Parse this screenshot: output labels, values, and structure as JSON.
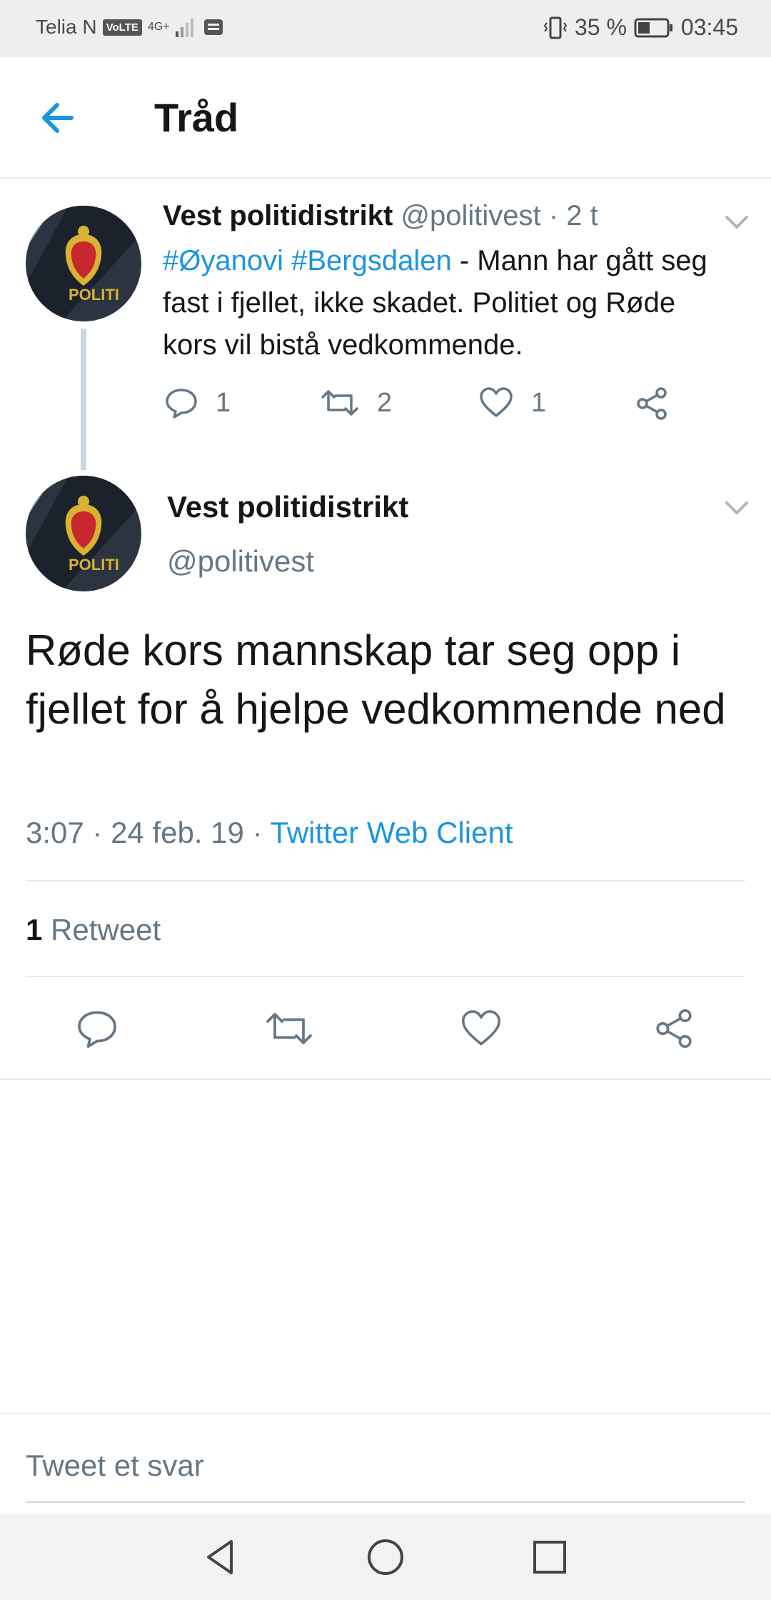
{
  "status_bar": {
    "carrier": "Telia N",
    "volte": "VoLTE",
    "network": "4G+",
    "battery": "35 %",
    "time": "03:45"
  },
  "header": {
    "title": "Tråd"
  },
  "tweet1": {
    "author": "Vest politidistrikt",
    "handle": "@politivest",
    "age": "· 2 t",
    "hashtag1": "#Øyanovi",
    "hashtag2": "#Bergsdalen",
    "text": "- Mann har gått seg fast i fjellet, ikke skadet. Politiet og Røde kors vil bistå vedkommende.",
    "replies": "1",
    "retweets": "2",
    "likes": "1"
  },
  "tweet2": {
    "author": "Vest politidistrikt",
    "handle": "@politivest",
    "text": "Røde kors mannskap tar seg opp i fjellet for å hjelpe vedkommende ned",
    "time_date": "3:07 · 24 feb. 19 ·",
    "source": "Twitter Web Client",
    "retweet_count": "1",
    "retweet_label": "Retweet"
  },
  "reply": {
    "placeholder": "Tweet et svar"
  },
  "avatar_text": "POLITI",
  "colors": {
    "accent": "#1b95e0",
    "muted": "#657786",
    "text": "#14171a"
  }
}
